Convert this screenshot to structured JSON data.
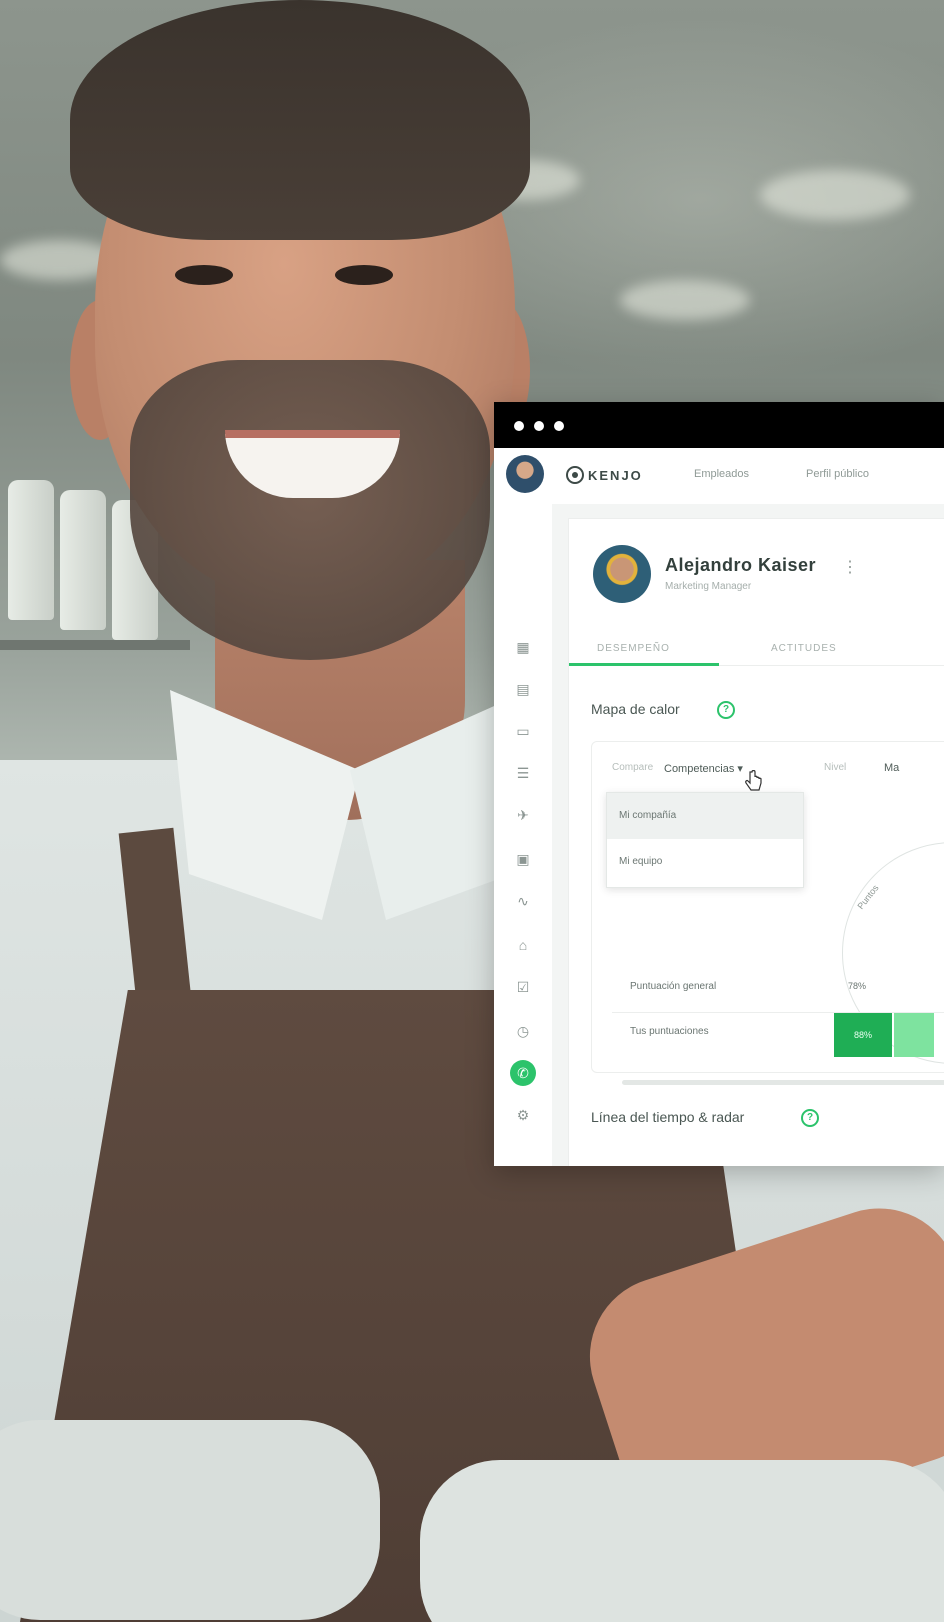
{
  "window": {
    "nav": {
      "logo": "KENJO",
      "links": [
        "Empleados",
        "Perfil público"
      ]
    },
    "profile": {
      "name": "Alejandro Kaiser",
      "role": "Marketing Manager"
    },
    "tabs": [
      "DESEMPEÑO",
      "ACTITUDES"
    ],
    "heatmap": {
      "title": "Mapa de calor",
      "help": "?",
      "filter1_label": "Compare",
      "filter1_value": "Competencias",
      "filter2_label": "Nivel",
      "filter2_value": "Ma",
      "dropdown_options": [
        "Mi compañía",
        "Mi equipo"
      ],
      "radar_label": "Puntos",
      "rows": [
        {
          "label": "Puntuación general",
          "value": "78%"
        },
        {
          "label": "Tus puntuaciones",
          "value": "88%"
        }
      ]
    },
    "timeline": {
      "title": "Línea del tiempo & radar",
      "help": "?"
    },
    "sidebar_icons": [
      "building-icon",
      "grid-icon",
      "briefcase-icon",
      "list-icon",
      "plane-icon",
      "calendar-icon",
      "chart-line-icon",
      "home-icon",
      "checklist-icon",
      "clock-icon",
      "chat-icon",
      "settings-icon"
    ]
  },
  "colors": {
    "accent": "#2cc36b",
    "score_dark": "#1fae55",
    "score_light": "#7ee39f",
    "titlebar": "#000000"
  }
}
